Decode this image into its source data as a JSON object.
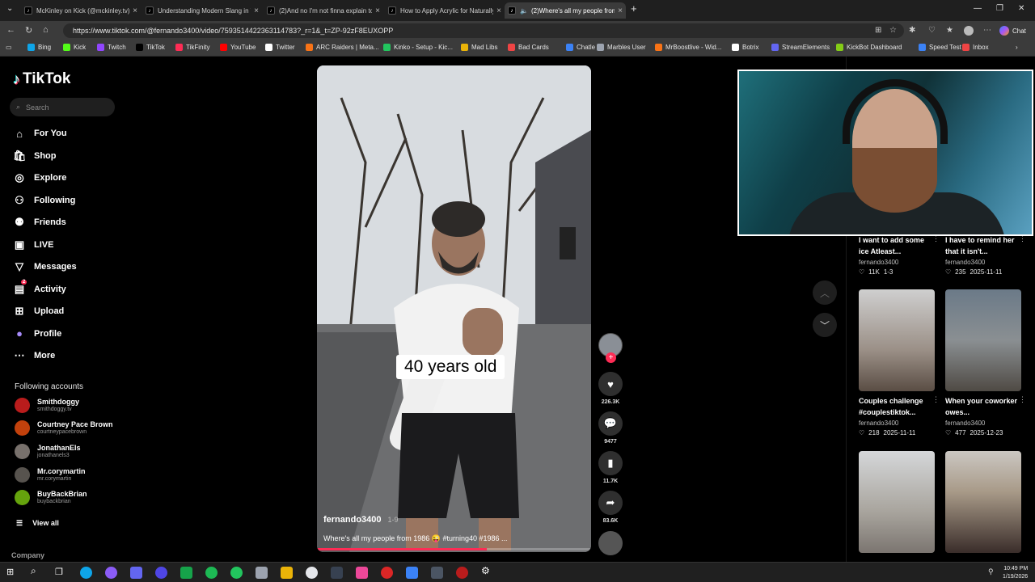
{
  "browser": {
    "tabs": [
      {
        "title": "McKinley on Kick (@mckinley.tv) |",
        "icon": "tiktok-icon"
      },
      {
        "title": "Understanding Modern Slang in W",
        "icon": "tiktok-icon"
      },
      {
        "title": "(2)And no I'm not finna explain to",
        "icon": "tiktok-icon"
      },
      {
        "title": "How to Apply Acrylic for Naturally",
        "icon": "tiktok-icon"
      },
      {
        "title": "(2)Where's all my people from",
        "icon": "tiktok-icon",
        "active": true
      }
    ],
    "url": "https://www.tiktok.com/@fernando3400/video/7593514422363114783?_r=1&_t=ZP-92zF8EUXOPP",
    "chat_label": "Chat",
    "bookmarks": [
      {
        "label": "Bing",
        "color": "#0ea5e9"
      },
      {
        "label": "Kick",
        "color": "#53fc18"
      },
      {
        "label": "Twitch",
        "color": "#9146ff"
      },
      {
        "label": "TikTok",
        "color": "#000000"
      },
      {
        "label": "TikFinity",
        "color": "#fe2c55"
      },
      {
        "label": "YouTube",
        "color": "#ff0000"
      },
      {
        "label": "Twitter",
        "color": "#ffffff"
      },
      {
        "label": "ARC Raiders | Meta...",
        "color": "#f97316"
      },
      {
        "label": "Kinko - Setup - Kic...",
        "color": "#22c55e"
      },
      {
        "label": "Mad Libs",
        "color": "#eab308"
      },
      {
        "label": "Bad Cards",
        "color": "#ef4444"
      },
      {
        "label": "Chatle",
        "color": "#3b82f6"
      },
      {
        "label": "Marbles User",
        "color": "#9ca3af"
      },
      {
        "label": "MrBoostlive - Wid...",
        "color": "#f97316"
      },
      {
        "label": "Botrix",
        "color": "#ffffff"
      },
      {
        "label": "StreamElements",
        "color": "#6366f1"
      },
      {
        "label": "KickBot Dashboard",
        "color": "#84cc16"
      },
      {
        "label": "Speed Test",
        "color": "#3b82f6"
      },
      {
        "label": "Inbox",
        "color": "#ef4444"
      }
    ]
  },
  "tiktok": {
    "logo": "TikTok",
    "search_placeholder": "Search",
    "nav": [
      {
        "label": "For You",
        "icon": "home-icon"
      },
      {
        "label": "Shop",
        "icon": "shop-icon"
      },
      {
        "label": "Explore",
        "icon": "compass-icon"
      },
      {
        "label": "Following",
        "icon": "following-icon"
      },
      {
        "label": "Friends",
        "icon": "friends-icon"
      },
      {
        "label": "LIVE",
        "icon": "live-icon"
      },
      {
        "label": "Messages",
        "icon": "messages-icon"
      },
      {
        "label": "Activity",
        "icon": "activity-icon",
        "badge": "2"
      },
      {
        "label": "Upload",
        "icon": "upload-icon"
      },
      {
        "label": "Profile",
        "icon": "profile-icon"
      },
      {
        "label": "More",
        "icon": "more-icon"
      }
    ],
    "following_title": "Following accounts",
    "following_accounts": [
      {
        "name": "Smithdoggy",
        "handle": "smithdoggy.tv",
        "color": "#b91c1c"
      },
      {
        "name": "Courtney Pace Brown",
        "handle": "courtneypacebrown",
        "color": "#c2410c"
      },
      {
        "name": "JonathanEls",
        "handle": "jonathanels3",
        "color": "#78716c"
      },
      {
        "name": "Mr.corymartin",
        "handle": "mr.corymartin",
        "color": "#57534e"
      },
      {
        "name": "BuyBackBrian",
        "handle": "buybackbrian",
        "color": "#65a30d"
      }
    ],
    "view_all": "View all",
    "company": "Company"
  },
  "video": {
    "overlay_text": "40 years old",
    "author": "fernando3400",
    "date": "1-9",
    "description": "Where's all my people from 1986 😜 #turning40 #1986 ...",
    "progress": 0.62,
    "likes": "226.3K",
    "comments": "9477",
    "saves": "11.7K",
    "shares": "83.6K"
  },
  "recommended": [
    {
      "title": "I want to add some ice Atleast...",
      "author": "fernando3400",
      "likes": "11K",
      "date": "1-3"
    },
    {
      "title": "I have to remind her that it isn't...",
      "author": "fernando3400",
      "likes": "235",
      "date": "2025-11-11"
    },
    {
      "title": "Couples challenge #couplestiktok...",
      "author": "fernando3400",
      "likes": "218",
      "date": "2025-11-11"
    },
    {
      "title": "When your coworker owes...",
      "author": "fernando3400",
      "likes": "477",
      "date": "2025-12-23"
    }
  ],
  "taskbar": {
    "time": "10:49 PM",
    "date": "1/19/2026"
  }
}
